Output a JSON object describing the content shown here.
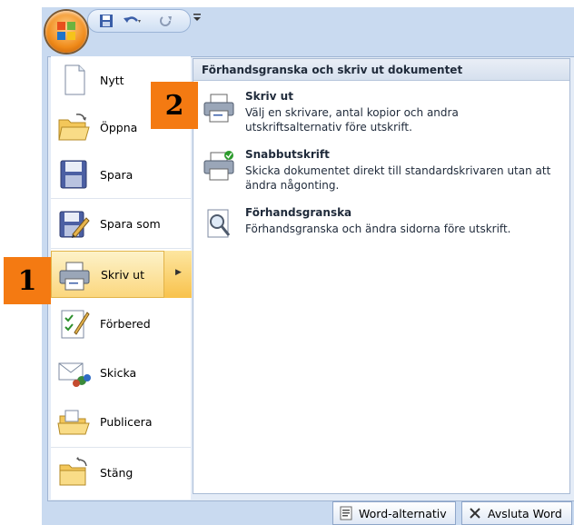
{
  "left_menu": {
    "items": [
      {
        "label": "Nytt",
        "has_arrow": false
      },
      {
        "label": "Öppna",
        "has_arrow": false
      },
      {
        "label": "Spara",
        "has_arrow": false
      },
      {
        "label": "Spara som",
        "has_arrow": true
      },
      {
        "label": "Skriv ut",
        "has_arrow": true,
        "selected": true
      },
      {
        "label": "Förbered",
        "has_arrow": true
      },
      {
        "label": "Skicka",
        "has_arrow": true
      },
      {
        "label": "Publicera",
        "has_arrow": true
      },
      {
        "label": "Stäng",
        "has_arrow": false
      }
    ]
  },
  "submenu": {
    "header": "Förhandsgranska och skriv ut dokumentet",
    "options": [
      {
        "title": "Skriv ut",
        "description": "Välj en skrivare, antal kopior och andra utskriftsalternativ före utskrift.",
        "icon": "printer-icon"
      },
      {
        "title": "Snabbutskrift",
        "description": "Skicka dokumentet direkt till standardskrivaren utan att ändra någonting.",
        "icon": "quick-print-icon"
      },
      {
        "title": "Förhandsgranska",
        "description": "Förhandsgranska och ändra sidorna före utskrift.",
        "icon": "print-preview-icon"
      }
    ]
  },
  "footer": {
    "options_label": "Word-alternativ",
    "exit_label": "Avsluta Word"
  },
  "annotations": {
    "badge1": "1",
    "badge2": "2"
  },
  "colors": {
    "badge": "#f47a12",
    "highlight": "#fbd77e",
    "frame": "#c9daf0"
  }
}
